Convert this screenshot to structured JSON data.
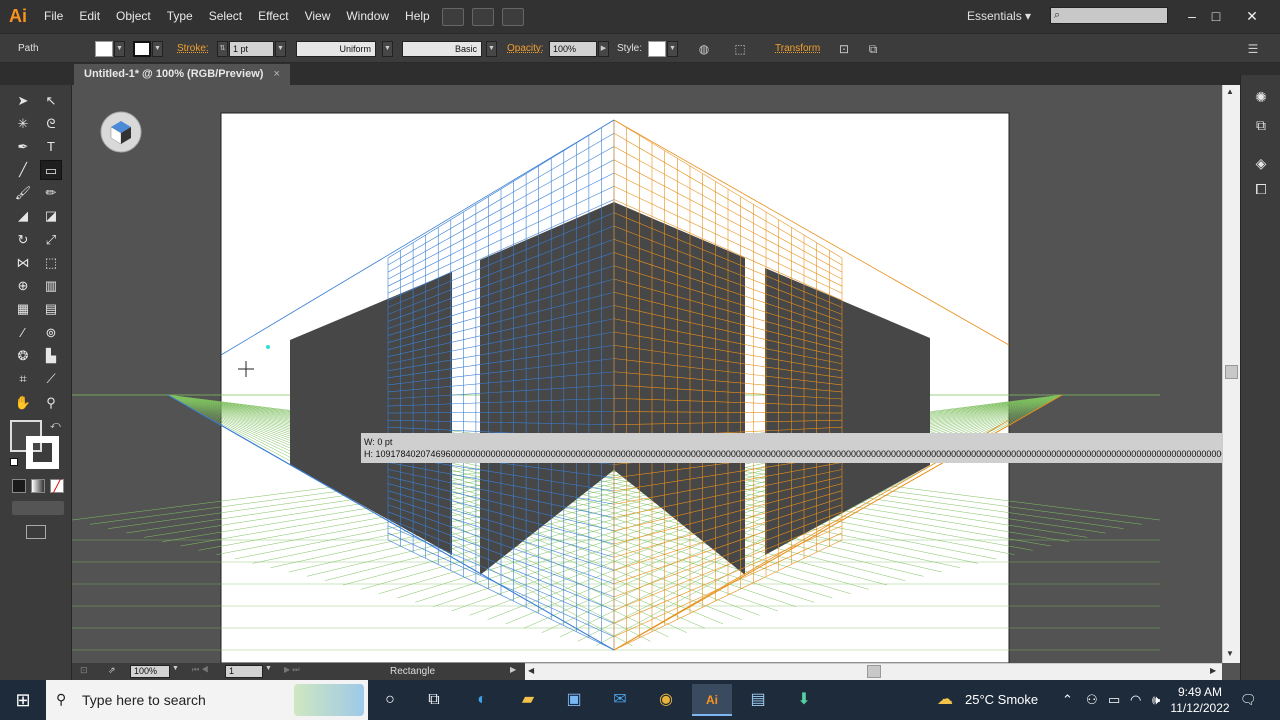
{
  "app": {
    "logo": "Ai"
  },
  "menu": [
    "File",
    "Edit",
    "Object",
    "Type",
    "Select",
    "Effect",
    "View",
    "Window",
    "Help"
  ],
  "workspace": {
    "label": "Essentials",
    "arrow": "▾"
  },
  "search": {
    "icon": "search-icon",
    "placeholder": ""
  },
  "window_controls": {
    "minimize": "–",
    "maximize": "□",
    "close": "✕"
  },
  "control": {
    "object_type": "Path",
    "stroke_label": "Stroke:",
    "stroke_value": "1 pt",
    "profile": "Uniform",
    "brush": "Basic",
    "opacity_label": "Opacity:",
    "opacity_value": "100%",
    "style_label": "Style:",
    "transform_label": "Transform"
  },
  "document": {
    "tab_title": "Untitled-1* @ 100% (RGB/Preview)",
    "close": "×"
  },
  "measure": {
    "w": "W: 0 pt",
    "h": "H: 109178402074696000000000000000000000000000000000000000000000000000000000000000000000000000000000000000000000000000000000000000000000000000000000000000000000000000000000000000000000000000000000000000"
  },
  "status": {
    "zoom": "100%",
    "artboard": "1",
    "tool_name": "Rectangle"
  },
  "taskbar": {
    "search_placeholder": "Type here to search",
    "weather": "25°C  Smoke",
    "time": "9:49 AM",
    "date": "11/12/2022"
  },
  "colors": {
    "left_grid": "#3a7fd5",
    "right_grid": "#e8901a",
    "ground_grid": "#7fc060",
    "face": "#474747",
    "accent": "#f7931e"
  }
}
